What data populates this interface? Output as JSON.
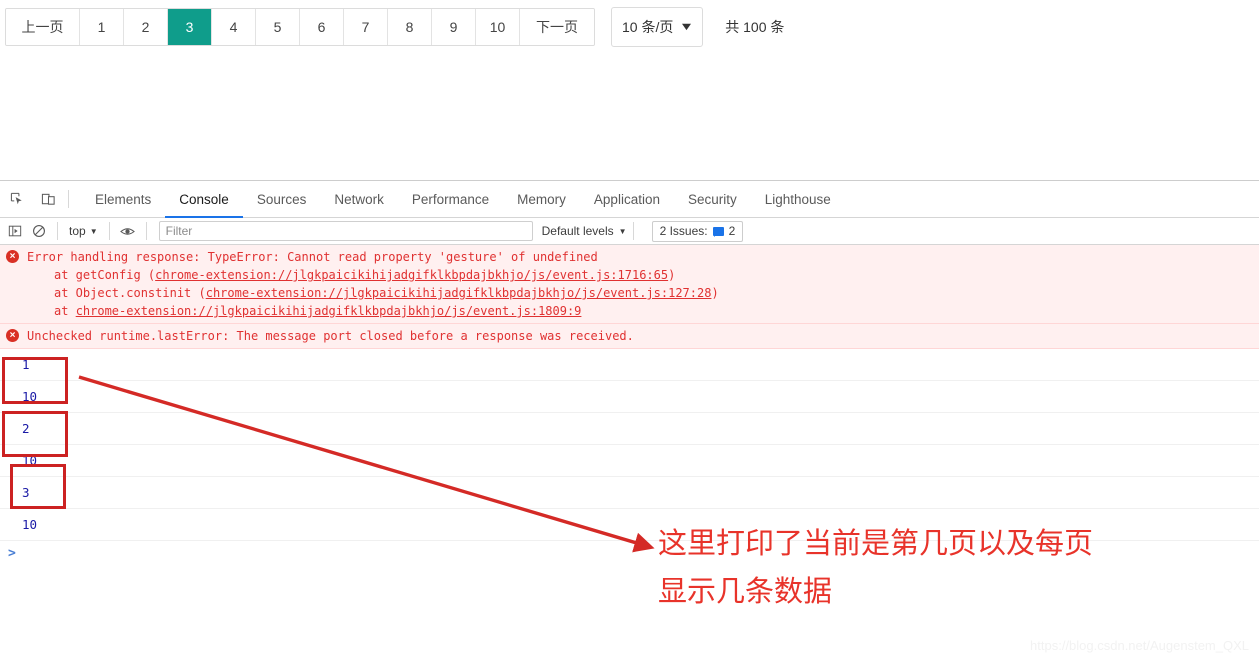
{
  "pagination": {
    "prev_label": "上一页",
    "pages": [
      "1",
      "2",
      "3",
      "4",
      "5",
      "6",
      "7",
      "8",
      "9",
      "10"
    ],
    "active_page": "3",
    "next_label": "下一页",
    "page_size_label": "10 条/页",
    "total_label": "共 100 条",
    "active_color": "#0f9d8b"
  },
  "devtools": {
    "icons": {
      "inspect": "inspect-element-icon",
      "device": "device-toolbar-icon",
      "sidebar": "console-sidebar-icon",
      "clear": "clear-console-icon",
      "eye": "live-expression-icon"
    },
    "tabs": [
      {
        "label": "Elements",
        "active": false
      },
      {
        "label": "Console",
        "active": true
      },
      {
        "label": "Sources",
        "active": false
      },
      {
        "label": "Network",
        "active": false
      },
      {
        "label": "Performance",
        "active": false
      },
      {
        "label": "Memory",
        "active": false
      },
      {
        "label": "Application",
        "active": false
      },
      {
        "label": "Security",
        "active": false
      },
      {
        "label": "Lighthouse",
        "active": false
      }
    ],
    "toolbar": {
      "context": "top",
      "filter_placeholder": "Filter",
      "filter_value": "",
      "levels": "Default levels",
      "issues_label": "2 Issues:",
      "issues_count": "2"
    },
    "console": {
      "error_group": {
        "headline": "Error handling response: TypeError: Cannot read property 'gesture' of undefined",
        "stack": [
          {
            "prefix": "at getConfig (",
            "link": "chrome-extension://jlgkpaicikihijadgifklkbpdajbkhjo/js/event.js:1716:65",
            "suffix": ")"
          },
          {
            "prefix": "at Object.constinit (",
            "link": "chrome-extension://jlgkpaicikihijadgifklkbpdajbkhjo/js/event.js:127:28",
            "suffix": ")"
          },
          {
            "prefix": "at ",
            "link": "chrome-extension://jlgkpaicikihijadgifklkbpdajbkhjo/js/event.js:1809:9",
            "suffix": ""
          }
        ]
      },
      "second_error": "Unchecked runtime.lastError: The message port closed before a response was received.",
      "logs": [
        "1",
        "10",
        "2",
        "10",
        "3",
        "10"
      ],
      "prompt": ">"
    }
  },
  "annotation": {
    "line1": "这里打印了当前是第几页以及每页",
    "line2": "显示几条数据",
    "color": "#e8332a",
    "watermark": "https://blog.csdn.net/Augenstem_QXL"
  }
}
